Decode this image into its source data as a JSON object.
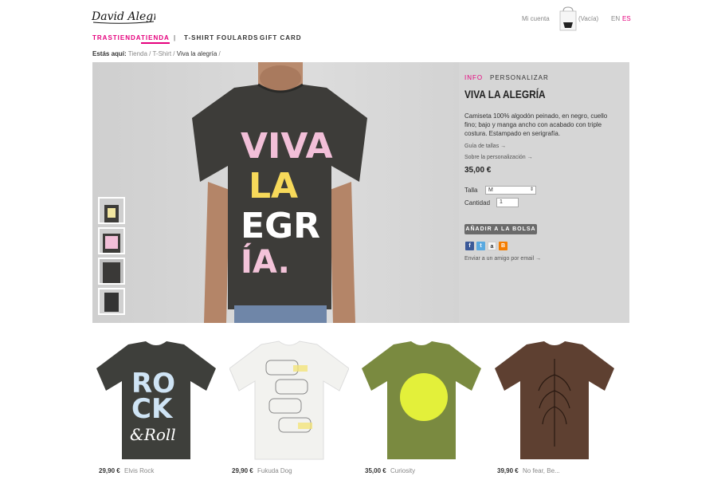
{
  "header": {
    "logo_text": "David Alegría",
    "account_label": "Mi cuenta",
    "bag_label": "(Vacía)",
    "lang_en": "EN",
    "lang_es": "ES"
  },
  "nav": {
    "items": [
      {
        "label": "TRASTIENDA"
      },
      {
        "label": "TIENDA"
      },
      {
        "label": "|"
      },
      {
        "label": "T-SHIRT"
      },
      {
        "label": "FOULARDS"
      },
      {
        "label": "GIFT CARD"
      }
    ]
  },
  "breadcrumb": {
    "prefix": "Estás aquí:",
    "items": [
      "Tienda",
      "/",
      "T-Shirt",
      "/",
      "Viva la alegría",
      "/"
    ]
  },
  "product": {
    "tab_info": "INFO",
    "tab_personalize": "PERSONALIZAR",
    "title": "VIVA LA ALEGRÍA",
    "description": "Camiseta 100% algodón peinado, en negro, cuello fino; bajo y manga ancho con acabado con triple costura. Estampado en serigrafía.",
    "size_guide_link": "Guía de tallas →",
    "personalize_link": "Sobre la personalización →",
    "price": "35,00 €",
    "size_label": "Talla",
    "size_value": "M",
    "qty_label": "Cantidad",
    "qty_value": "1",
    "add_button": "AÑADIR A LA BOLSA",
    "share_icons": [
      "facebook-icon",
      "twitter-icon",
      "amazon-icon",
      "blogger-icon"
    ],
    "send_friend": "Enviar a un amigo por email →",
    "shirt_print": "VIVA LA EGRIA"
  },
  "related": [
    {
      "price": "29,90 €",
      "name": "Elvis Rock",
      "color": "#3e3f3b",
      "print": [
        "RO",
        "CK",
        "&Roll"
      ]
    },
    {
      "price": "29,90 €",
      "name": "Fukuda Dog",
      "color": "#f1f1ee",
      "print": []
    },
    {
      "price": "35,00 €",
      "name": "Curiosity",
      "color": "#7a8a40",
      "print": []
    },
    {
      "price": "39,90 €",
      "name": "No fear, Be...",
      "color": "#5e4031",
      "print": []
    }
  ],
  "colors": {
    "accent": "#e5007d",
    "hero_bg": "#d6d6d6"
  }
}
